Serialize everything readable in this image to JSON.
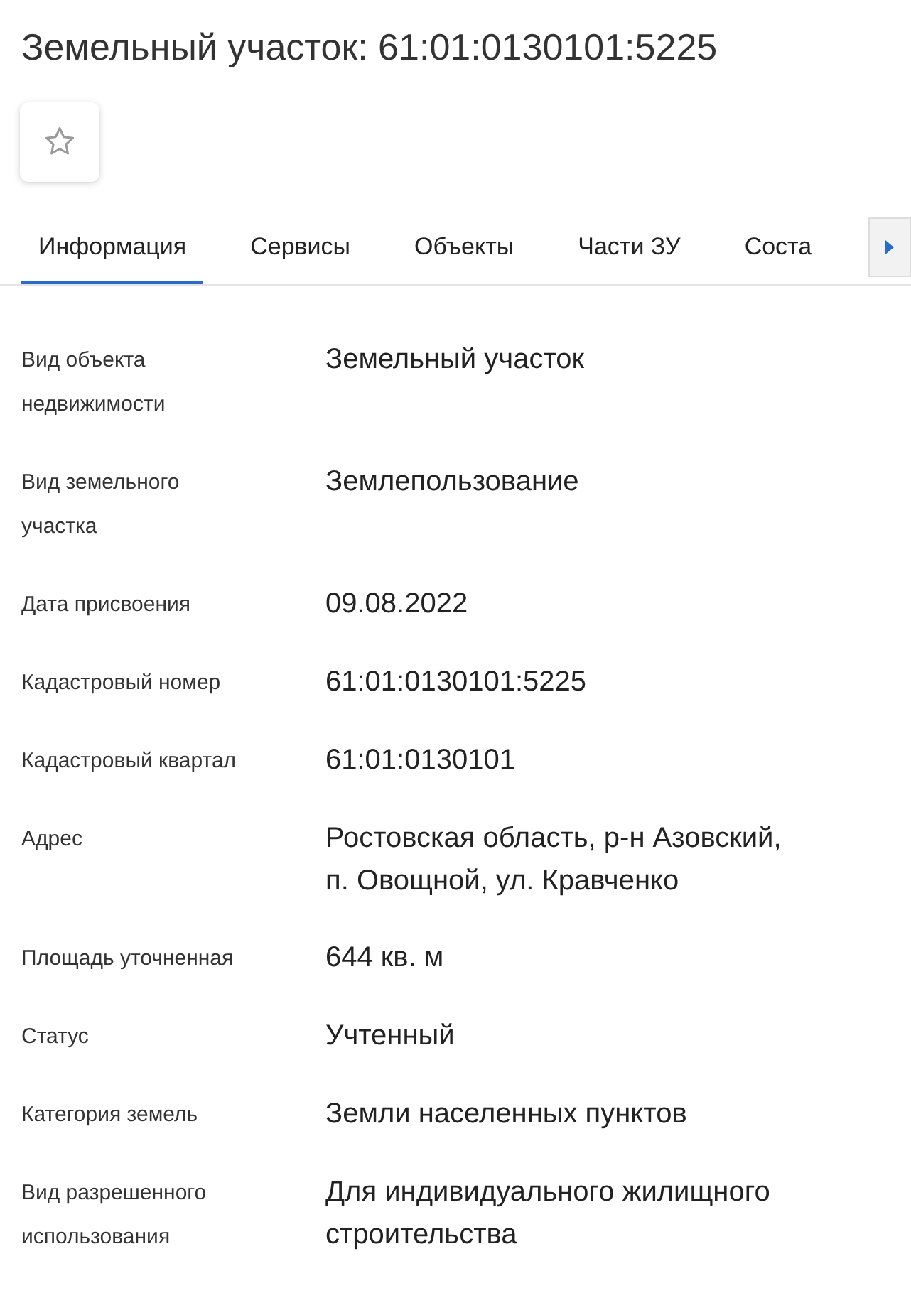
{
  "title": "Земельный участок: 61:01:0130101:5225",
  "favorite": {
    "on": false
  },
  "tabs": [
    {
      "label": "Информация",
      "selected": true
    },
    {
      "label": "Сервисы",
      "selected": false
    },
    {
      "label": "Объекты",
      "selected": false
    },
    {
      "label": "Части ЗУ",
      "selected": false
    },
    {
      "label": "Соста",
      "selected": false
    }
  ],
  "fields": [
    {
      "label": [
        "Вид объекта",
        "недвижимости"
      ],
      "value": [
        "Земельный участок"
      ]
    },
    {
      "label": [
        "Вид земельного",
        "участка"
      ],
      "value": [
        "Землепользование"
      ]
    },
    {
      "label": [
        "Дата присвоения"
      ],
      "value": [
        "09.08.2022"
      ]
    },
    {
      "label": [
        "Кадастровый номер"
      ],
      "value": [
        "61:01:0130101:5225"
      ]
    },
    {
      "label": [
        "Кадастровый квартал"
      ],
      "value": [
        "61:01:0130101"
      ]
    },
    {
      "label": [
        "Адрес"
      ],
      "value": [
        "Ростовская область, р-н Азовский,",
        "п. Овощной, ул. Кравченко"
      ]
    },
    {
      "label": [
        "Площадь уточненная"
      ],
      "value": [
        "644 кв. м"
      ]
    },
    {
      "label": [
        "Статус"
      ],
      "value": [
        "Учтенный"
      ]
    },
    {
      "label": [
        "Категория земель"
      ],
      "value": [
        "Земли населенных пунктов"
      ]
    },
    {
      "label": [
        "Вид разрешенного",
        "использования"
      ],
      "value": [
        "Для индивидуального жилищного",
        "строительства"
      ]
    }
  ]
}
